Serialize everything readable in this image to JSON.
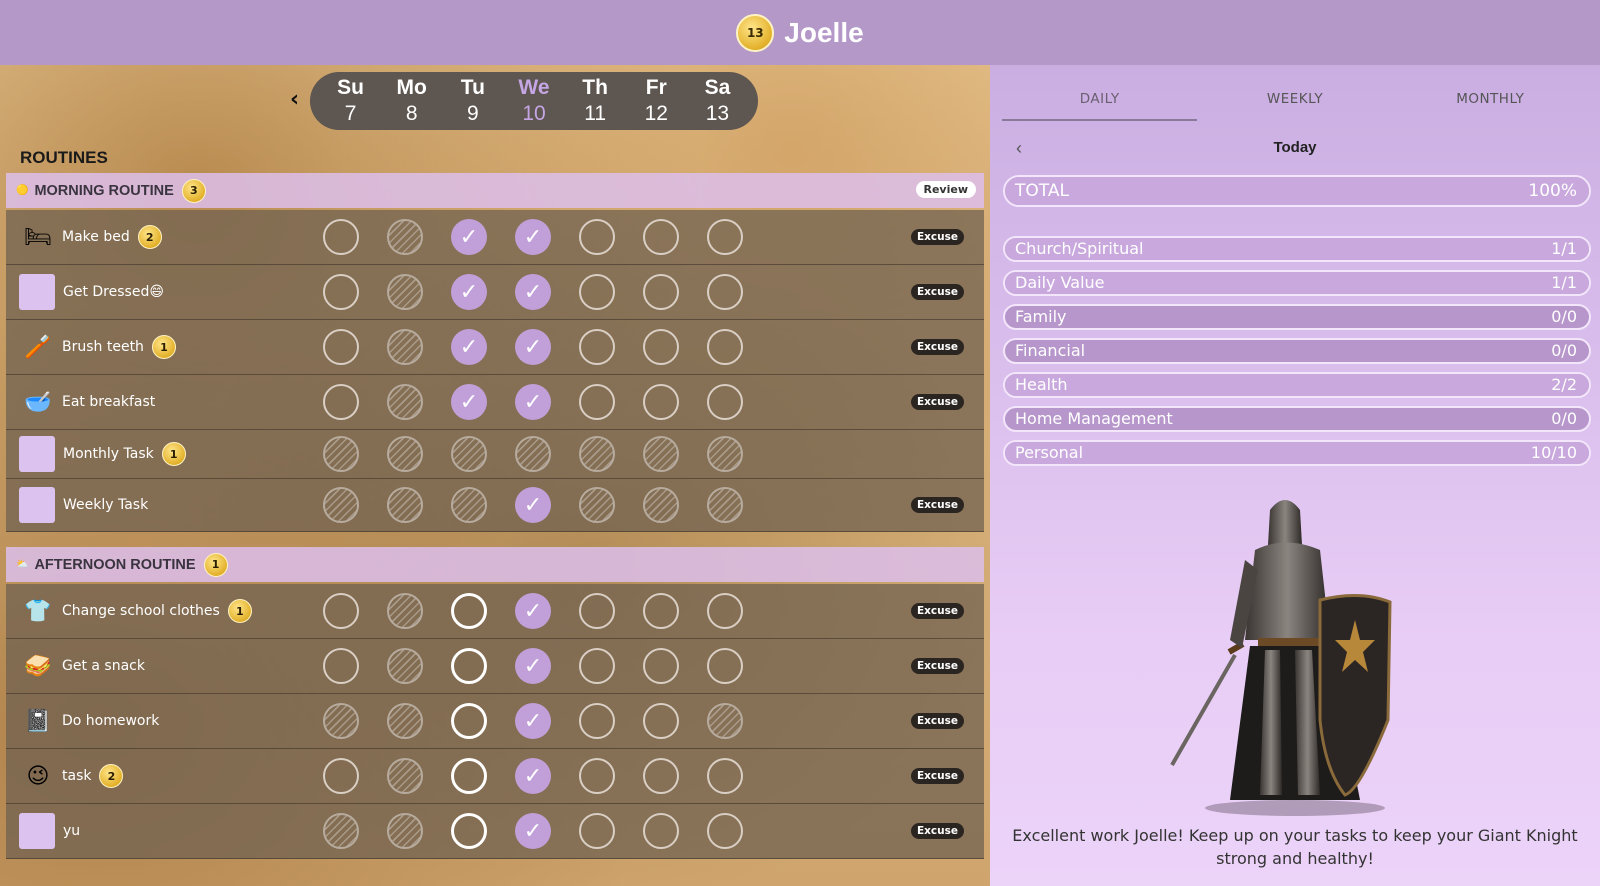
{
  "header": {
    "coins": "13",
    "user_name": "Joelle"
  },
  "week": {
    "days": [
      {
        "name": "Su",
        "date": "7"
      },
      {
        "name": "Mo",
        "date": "8"
      },
      {
        "name": "Tu",
        "date": "9"
      },
      {
        "name": "We",
        "date": "10"
      },
      {
        "name": "Th",
        "date": "11"
      },
      {
        "name": "Fr",
        "date": "12"
      },
      {
        "name": "Sa",
        "date": "13"
      }
    ],
    "today_index": 3
  },
  "routines_title": "ROUTINES",
  "groups": [
    {
      "name": "MORNING ROUTINE",
      "count": "3",
      "review_label": "Review",
      "tasks": [
        {
          "name": "Make bed",
          "icon": "bed-icon",
          "glyph": "🛏",
          "count": "2",
          "cells": [
            "empty",
            "hatch",
            "done",
            "done",
            "empty",
            "empty",
            "empty"
          ],
          "excuse": "Excuse"
        },
        {
          "name": "Get Dressed😄",
          "icon": "placeholder-square",
          "cells": [
            "empty",
            "hatch",
            "done",
            "done",
            "empty",
            "empty",
            "empty"
          ],
          "excuse": "Excuse"
        },
        {
          "name": "Brush teeth",
          "icon": "toothbrush-icon",
          "glyph": "🪥",
          "count": "1",
          "cells": [
            "empty",
            "hatch",
            "done",
            "done",
            "empty",
            "empty",
            "empty"
          ],
          "excuse": "Excuse"
        },
        {
          "name": "Eat breakfast",
          "icon": "bowl-icon",
          "glyph": "🥣",
          "cells": [
            "empty",
            "hatch",
            "done",
            "done",
            "empty",
            "empty",
            "empty"
          ],
          "excuse": "Excuse"
        },
        {
          "name": "Monthly Task",
          "icon": "placeholder-square",
          "count": "1",
          "cells": [
            "hatch",
            "hatch",
            "hatch",
            "hatch",
            "hatch",
            "hatch",
            "hatch"
          ]
        },
        {
          "name": "Weekly Task",
          "icon": "placeholder-square",
          "cells": [
            "hatch",
            "hatch",
            "hatch",
            "done",
            "hatch",
            "hatch",
            "hatch"
          ],
          "excuse": "Excuse"
        }
      ]
    },
    {
      "name": "AFTERNOON ROUTINE",
      "count": "1",
      "tasks": [
        {
          "name": "Change school clothes",
          "icon": "shirt-icon",
          "glyph": "👕",
          "count": "1",
          "cells": [
            "empty",
            "hatch",
            "bold",
            "done",
            "empty",
            "empty",
            "empty"
          ],
          "excuse": "Excuse"
        },
        {
          "name": "Get a snack",
          "icon": "sandwich-icon",
          "glyph": "🥪",
          "cells": [
            "empty",
            "hatch",
            "bold",
            "done",
            "empty",
            "empty",
            "empty"
          ],
          "excuse": "Excuse"
        },
        {
          "name": "Do homework",
          "icon": "notebook-icon",
          "glyph": "📓",
          "cells": [
            "hatch",
            "hatch",
            "bold",
            "done",
            "empty",
            "empty",
            "hatch"
          ],
          "excuse": "Excuse"
        },
        {
          "name": "task",
          "icon": "wink-face-icon",
          "glyph": "😉",
          "count": "2",
          "cells": [
            "empty",
            "hatch",
            "bold",
            "done",
            "empty",
            "empty",
            "empty"
          ],
          "excuse": "Excuse"
        },
        {
          "name": "yu",
          "icon": "placeholder-square",
          "cells": [
            "hatch",
            "hatch",
            "bold",
            "done",
            "empty",
            "empty",
            "empty"
          ],
          "excuse": "Excuse"
        }
      ]
    }
  ],
  "stats": {
    "tabs": [
      "DAILY",
      "WEEKLY",
      "MONTHLY"
    ],
    "active_tab": 0,
    "period_label": "Today",
    "total": {
      "label": "TOTAL",
      "value": "100%",
      "fraction": 1.0
    },
    "categories": [
      {
        "label": "Church/Spiritual",
        "value": "1/1",
        "fraction": 1.0
      },
      {
        "label": "Daily Value",
        "value": "1/1",
        "fraction": 1.0
      },
      {
        "label": "Family",
        "value": "0/0",
        "fraction": 0
      },
      {
        "label": "Financial",
        "value": "0/0",
        "fraction": 0
      },
      {
        "label": "Health",
        "value": "2/2",
        "fraction": 1.0
      },
      {
        "label": "Home Management",
        "value": "0/0",
        "fraction": 0
      },
      {
        "label": "Personal",
        "value": "10/10",
        "fraction": 1.0
      }
    ],
    "message": "Excellent work Joelle! Keep up on your tasks to keep your Giant Knight strong and healthy!"
  }
}
